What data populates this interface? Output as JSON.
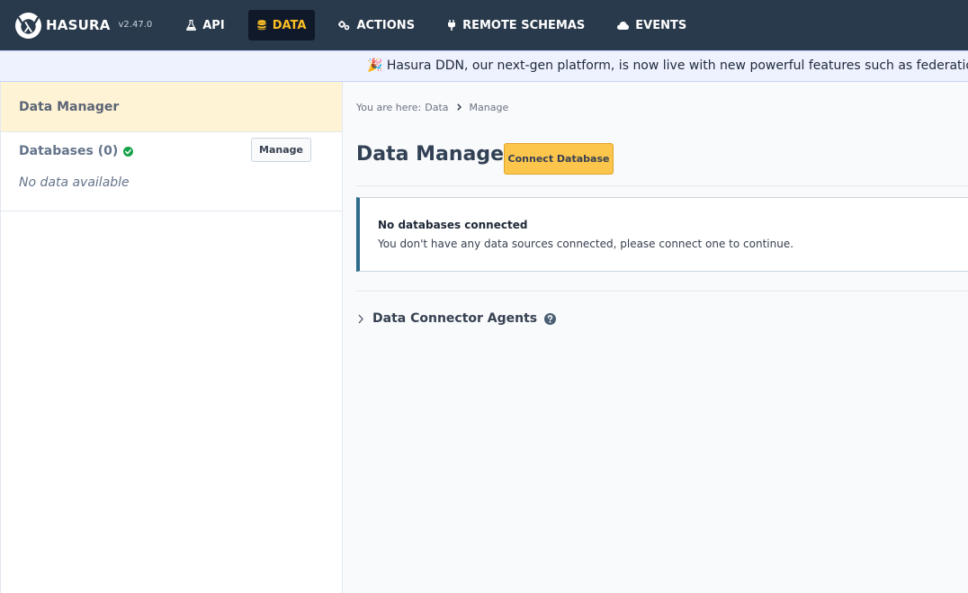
{
  "app": {
    "logo_text": "HASURA",
    "version": "v2.47.0"
  },
  "nav": [
    {
      "label": "API",
      "icon": "flask-icon",
      "active": false
    },
    {
      "label": "DATA",
      "icon": "database-icon",
      "active": true
    },
    {
      "label": "ACTIONS",
      "icon": "gears-icon",
      "active": false
    },
    {
      "label": "REMOTE SCHEMAS",
      "icon": "plug-icon",
      "active": false
    },
    {
      "label": "EVENTS",
      "icon": "cloud-icon",
      "active": false
    }
  ],
  "banner": {
    "emoji": "🎉",
    "text": "Hasura DDN, our next-gen platform, is now live with new powerful features such as federation, lambda connectors and more."
  },
  "sidebar": {
    "title": "Data Manager",
    "databases_label": "Databases (0)",
    "manage_label": "Manage",
    "empty_text": "No data available"
  },
  "main": {
    "breadcrumb": {
      "prefix": "You are here:",
      "items": [
        "Data",
        "Manage"
      ]
    },
    "title": "Data Manager",
    "connect_label": "Connect Database",
    "alert": {
      "title": "No databases connected",
      "body": "You don't have any data sources connected, please connect one to continue."
    },
    "agents_label": "Data Connector Agents"
  },
  "colors": {
    "nav_bg": "#293a4c",
    "active_text": "#fbbf24",
    "accent_button": "#fcc54c",
    "status_ok": "#16a34a"
  }
}
